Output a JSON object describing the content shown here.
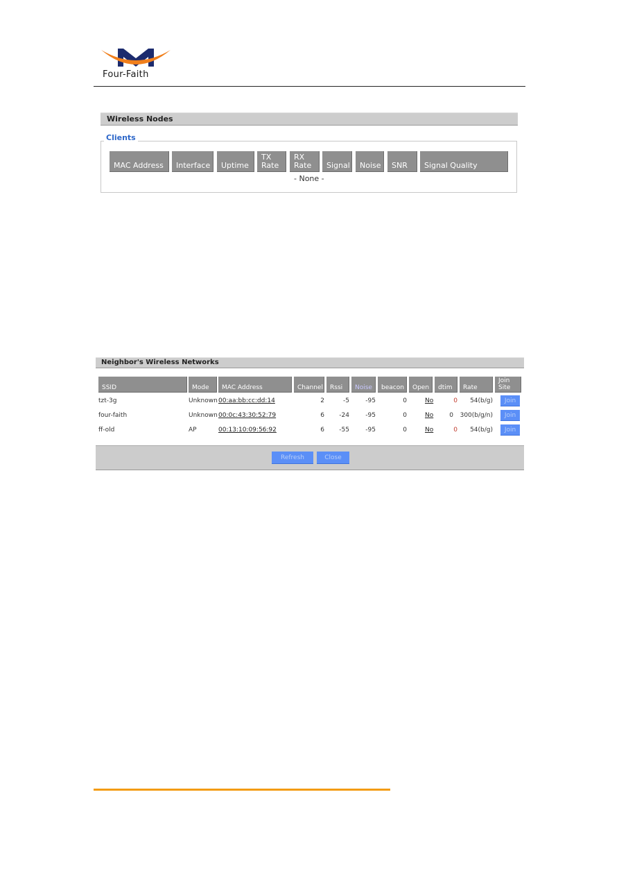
{
  "header": {
    "brand": "Four-Faith",
    "logo_icon": "four-faith-logo-icon",
    "colors": {
      "logo_arc": "#f07f1c",
      "logo_m": "#1c2b6e",
      "footer_rule": "#f39c12"
    }
  },
  "wireless_nodes": {
    "title": "Wireless Nodes",
    "clients": {
      "legend": "Clients",
      "columns": [
        {
          "line1": "",
          "line2": "MAC Address"
        },
        {
          "line1": "",
          "line2": "Interface"
        },
        {
          "line1": "",
          "line2": "Uptime"
        },
        {
          "line1": "TX",
          "line2": "Rate"
        },
        {
          "line1": "RX",
          "line2": "Rate"
        },
        {
          "line1": "",
          "line2": "Signal"
        },
        {
          "line1": "",
          "line2": "Noise"
        },
        {
          "line1": "",
          "line2": "SNR"
        },
        {
          "line1": "",
          "line2": "Signal Quality"
        }
      ],
      "empty_text": "- None -"
    }
  },
  "neighbors": {
    "title": "Neighbor's Wireless Networks",
    "columns": [
      {
        "line1": "",
        "line2": "SSID"
      },
      {
        "line1": "",
        "line2": "Mode"
      },
      {
        "line1": "",
        "line2": "MAC Address"
      },
      {
        "line1": "",
        "line2": "Channel"
      },
      {
        "line1": "",
        "line2": "Rssi"
      },
      {
        "line1": "",
        "line2": "Noise"
      },
      {
        "line1": "",
        "line2": "beacon"
      },
      {
        "line1": "",
        "line2": "Open"
      },
      {
        "line1": "",
        "line2": "dtim"
      },
      {
        "line1": "",
        "line2": "Rate"
      },
      {
        "line1": "Join",
        "line2": "Site"
      }
    ],
    "rows": [
      {
        "ssid": "tzt-3g",
        "mode": "Unknown",
        "mac": "00:aa:bb:cc:dd:14",
        "channel": "2",
        "rssi": "-5",
        "noise": "-95",
        "beacon": "0",
        "open": "No",
        "dtim": "0",
        "rate": "54(b/g)",
        "join": "Join"
      },
      {
        "ssid": "four-faith",
        "mode": "Unknown",
        "mac": "00:0c:43:30:52:79",
        "channel": "6",
        "rssi": "-24",
        "noise": "-95",
        "beacon": "0",
        "open": "No",
        "dtim": "0",
        "rate": "300(b/g/n)",
        "join": "Join"
      },
      {
        "ssid": "ff-old",
        "mode": "AP",
        "mac": "00:13:10:09:56:92",
        "channel": "6",
        "rssi": "-55",
        "noise": "-95",
        "beacon": "0",
        "open": "No",
        "dtim": "0",
        "rate": "54(b/g)",
        "join": "Join"
      }
    ],
    "buttons": {
      "refresh": "Refresh",
      "close": "Close"
    }
  }
}
